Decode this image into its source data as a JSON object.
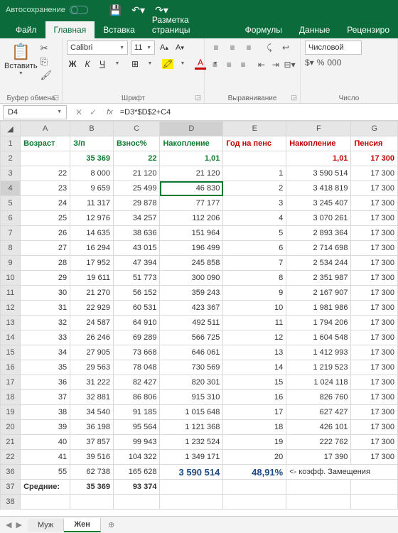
{
  "titlebar": {
    "autosave": "Автосохранение"
  },
  "tabs": {
    "file": "Файл",
    "home": "Главная",
    "insert": "Вставка",
    "layout": "Разметка страницы",
    "formulas": "Формулы",
    "data": "Данные",
    "review": "Рецензиро"
  },
  "ribbon": {
    "clipboard": {
      "label": "Буфер обмена",
      "paste": "Вставить"
    },
    "font": {
      "label": "Шрифт",
      "name": "Calibri",
      "size": "11",
      "bold": "Ж",
      "italic": "К",
      "underline": "Ч"
    },
    "align": {
      "label": "Выравнивание"
    },
    "number": {
      "label": "Число",
      "format": "Числовой"
    }
  },
  "namebox": "D4",
  "formula": "=D3*$D$2+C4",
  "cols": [
    "A",
    "B",
    "C",
    "D",
    "E",
    "F",
    "G"
  ],
  "headers": {
    "A": "Возраст",
    "B": "З/п",
    "C": "Взнос%",
    "D": "Накопление",
    "E": "Год на пенс",
    "F": "Накопление",
    "G": "Пенсия"
  },
  "row2": {
    "B": "35 369",
    "C": "22",
    "D": "1,01",
    "F": "1,01",
    "G": "17 300"
  },
  "rows": [
    {
      "n": "3",
      "A": "22",
      "B": "8 000",
      "C": "21 120",
      "D": "21 120",
      "E": "1",
      "F": "3 590 514",
      "G": "17 300"
    },
    {
      "n": "4",
      "A": "23",
      "B": "9 659",
      "C": "25 499",
      "D": "46 830",
      "E": "2",
      "F": "3 418 819",
      "G": "17 300"
    },
    {
      "n": "5",
      "A": "24",
      "B": "11 317",
      "C": "29 878",
      "D": "77 177",
      "E": "3",
      "F": "3 245 407",
      "G": "17 300"
    },
    {
      "n": "6",
      "A": "25",
      "B": "12 976",
      "C": "34 257",
      "D": "112 206",
      "E": "4",
      "F": "3 070 261",
      "G": "17 300"
    },
    {
      "n": "7",
      "A": "26",
      "B": "14 635",
      "C": "38 636",
      "D": "151 964",
      "E": "5",
      "F": "2 893 364",
      "G": "17 300"
    },
    {
      "n": "8",
      "A": "27",
      "B": "16 294",
      "C": "43 015",
      "D": "196 499",
      "E": "6",
      "F": "2 714 698",
      "G": "17 300"
    },
    {
      "n": "9",
      "A": "28",
      "B": "17 952",
      "C": "47 394",
      "D": "245 858",
      "E": "7",
      "F": "2 534 244",
      "G": "17 300"
    },
    {
      "n": "10",
      "A": "29",
      "B": "19 611",
      "C": "51 773",
      "D": "300 090",
      "E": "8",
      "F": "2 351 987",
      "G": "17 300"
    },
    {
      "n": "11",
      "A": "30",
      "B": "21 270",
      "C": "56 152",
      "D": "359 243",
      "E": "9",
      "F": "2 167 907",
      "G": "17 300"
    },
    {
      "n": "12",
      "A": "31",
      "B": "22 929",
      "C": "60 531",
      "D": "423 367",
      "E": "10",
      "F": "1 981 986",
      "G": "17 300"
    },
    {
      "n": "13",
      "A": "32",
      "B": "24 587",
      "C": "64 910",
      "D": "492 511",
      "E": "11",
      "F": "1 794 206",
      "G": "17 300"
    },
    {
      "n": "14",
      "A": "33",
      "B": "26 246",
      "C": "69 289",
      "D": "566 725",
      "E": "12",
      "F": "1 604 548",
      "G": "17 300"
    },
    {
      "n": "15",
      "A": "34",
      "B": "27 905",
      "C": "73 668",
      "D": "646 061",
      "E": "13",
      "F": "1 412 993",
      "G": "17 300"
    },
    {
      "n": "16",
      "A": "35",
      "B": "29 563",
      "C": "78 048",
      "D": "730 569",
      "E": "14",
      "F": "1 219 523",
      "G": "17 300"
    },
    {
      "n": "17",
      "A": "36",
      "B": "31 222",
      "C": "82 427",
      "D": "820 301",
      "E": "15",
      "F": "1 024 118",
      "G": "17 300"
    },
    {
      "n": "18",
      "A": "37",
      "B": "32 881",
      "C": "86 806",
      "D": "915 310",
      "E": "16",
      "F": "826 760",
      "G": "17 300"
    },
    {
      "n": "19",
      "A": "38",
      "B": "34 540",
      "C": "91 185",
      "D": "1 015 648",
      "E": "17",
      "F": "627 427",
      "G": "17 300"
    },
    {
      "n": "20",
      "A": "39",
      "B": "36 198",
      "C": "95 564",
      "D": "1 121 368",
      "E": "18",
      "F": "426 101",
      "G": "17 300"
    },
    {
      "n": "21",
      "A": "40",
      "B": "37 857",
      "C": "99 943",
      "D": "1 232 524",
      "E": "19",
      "F": "222 762",
      "G": "17 300"
    },
    {
      "n": "22",
      "A": "41",
      "B": "39 516",
      "C": "104 322",
      "D": "1 349 171",
      "E": "20",
      "F": "17 390",
      "G": "17 300"
    }
  ],
  "row36": {
    "n": "36",
    "A": "55",
    "B": "62 738",
    "C": "165 628",
    "D": "3 590 514",
    "E": "48,91%",
    "F": "<- коэфф. Замещения"
  },
  "row37": {
    "n": "37",
    "A": "Средние:",
    "B": "35 369",
    "C": "93 374"
  },
  "row38": {
    "n": "38"
  },
  "sheets": {
    "s1": "Муж",
    "s2": "Жен"
  }
}
